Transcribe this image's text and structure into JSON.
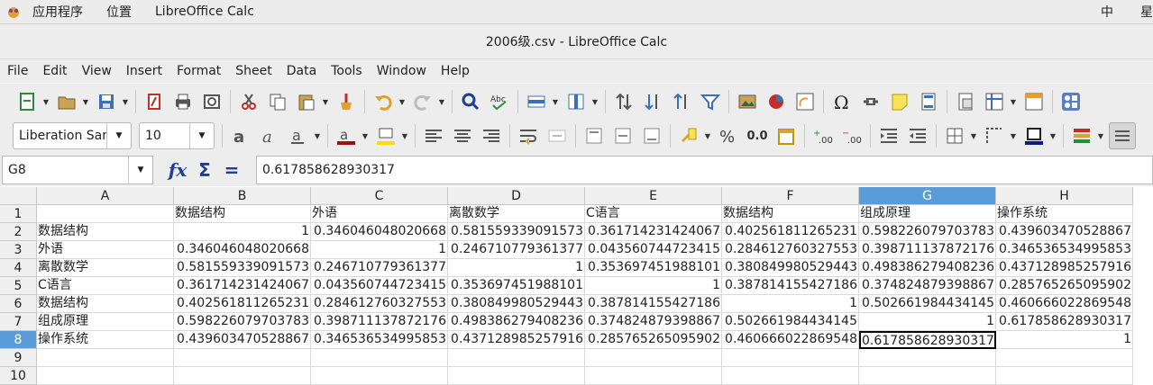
{
  "system_bar": {
    "applications": "应用程序",
    "places": "位置",
    "active_app": "LibreOffice Calc",
    "input_method": "中",
    "weekday": "星"
  },
  "window": {
    "title": "2006级.csv - LibreOffice Calc"
  },
  "menu": [
    "File",
    "Edit",
    "View",
    "Insert",
    "Format",
    "Sheet",
    "Data",
    "Tools",
    "Window",
    "Help"
  ],
  "format_bar": {
    "font_name": "Liberation Sans",
    "font_size": "10",
    "number_format_label": "0.0"
  },
  "formula_bar": {
    "cell_ref": "G8",
    "content": "0.617858628930317"
  },
  "sheet": {
    "columns": [
      "A",
      "B",
      "C",
      "D",
      "E",
      "F",
      "G",
      "H"
    ],
    "selected_column": "G",
    "selected_row": 8,
    "rows": [
      {
        "n": "1",
        "cells": [
          "",
          "数据结构",
          "外语",
          "离散数学",
          "C语言",
          "数据结构",
          "组成原理",
          "操作系统"
        ]
      },
      {
        "n": "2",
        "cells": [
          "数据结构",
          "1",
          "0.346046048020668",
          "0.581559339091573",
          "0.361714231424067",
          "0.402561811265231",
          "0.598226079703783",
          "0.439603470528867"
        ]
      },
      {
        "n": "3",
        "cells": [
          "外语",
          "0.346046048020668",
          "1",
          "0.246710779361377",
          "0.043560744723415",
          "0.284612760327553",
          "0.398711137872176",
          "0.346536534995853"
        ]
      },
      {
        "n": "4",
        "cells": [
          "离散数学",
          "0.581559339091573",
          "0.246710779361377",
          "1",
          "0.353697451988101",
          "0.380849980529443",
          "0.498386279408236",
          "0.437128985257916"
        ]
      },
      {
        "n": "5",
        "cells": [
          "C语言",
          "0.361714231424067",
          "0.043560744723415",
          "0.353697451988101",
          "1",
          "0.387814155427186",
          "0.374824879398867",
          "0.285765265095902"
        ]
      },
      {
        "n": "6",
        "cells": [
          "数据结构",
          "0.402561811265231",
          "0.284612760327553",
          "0.380849980529443",
          "0.387814155427186",
          "1",
          "0.502661984434145",
          "0.460666022869548"
        ]
      },
      {
        "n": "7",
        "cells": [
          "组成原理",
          "0.598226079703783",
          "0.398711137872176",
          "0.498386279408236",
          "0.374824879398867",
          "0.502661984434145",
          "1",
          "0.617858628930317"
        ]
      },
      {
        "n": "8",
        "cells": [
          "操作系统",
          "0.439603470528867",
          "0.346536534995853",
          "0.437128985257916",
          "0.285765265095902",
          "0.460666022869548",
          "0.617858628930317",
          "1"
        ]
      },
      {
        "n": "9",
        "cells": [
          "",
          "",
          "",
          "",
          "",
          "",
          "",
          ""
        ]
      },
      {
        "n": "10",
        "cells": [
          "",
          "",
          "",
          "",
          "",
          "",
          "",
          ""
        ]
      }
    ]
  },
  "colors": {
    "selection_header": "#5a9bd8",
    "chrome": "#ededed"
  }
}
